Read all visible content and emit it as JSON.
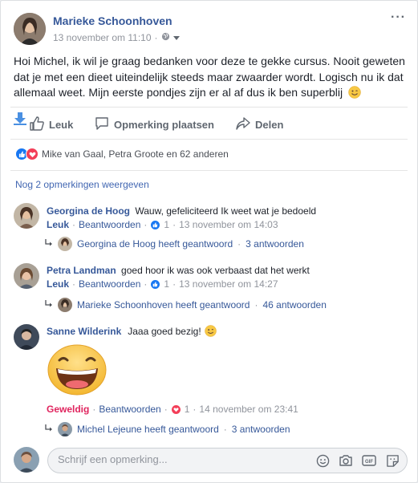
{
  "post": {
    "author": "Marieke Schoonhoven",
    "timestamp": "13 november om 11:10",
    "text": "Hoi Michel, ik wil je graag bedanken voor deze te gekke cursus. Nooit geweten dat je met een dieet uiteindelijk steeds maar zwaarder wordt. Logisch nu ik dat allemaal weet. Mijn eerste pondjes zijn er al af dus ik ben superblij",
    "more_label": "···"
  },
  "actions": {
    "like": "Leuk",
    "comment": "Opmerking plaatsen",
    "share": "Delen"
  },
  "reactions": {
    "summary": "Mike van Gaal, Petra Groote en 62 anderen"
  },
  "more_comments": "Nog 2 opmerkingen weergeven",
  "comments": [
    {
      "author": "Georgina de Hoog",
      "text": "Wauw, gefeliciteerd  Ik weet wat je bedoeld",
      "like_label": "Leuk",
      "reply_label": "Beantwoorden",
      "reaction_count": "1",
      "time": "13 november om 14:03",
      "reply": {
        "who": "Georgina de Hoog heeft geantwoord",
        "count": "3 antwoorden"
      }
    },
    {
      "author": "Petra Landman",
      "text": "goed hoor  ik was ook verbaast dat het werkt",
      "like_label": "Leuk",
      "reply_label": "Beantwoorden",
      "reaction_count": "1",
      "time": "13 november om 14:27",
      "reply": {
        "who": "Marieke Schoonhoven heeft geantwoord",
        "count": "46 antwoorden"
      }
    },
    {
      "author": "Sanne Wilderink",
      "text": "Jaaa goed bezig!",
      "like_label": "Geweldig",
      "reply_label": "Beantwoorden",
      "reaction_count": "1",
      "time": "14 november om 23:41",
      "reply": {
        "who": "Michel Lejeune heeft geantwoord",
        "count": "3 antwoorden"
      }
    }
  ],
  "composer": {
    "placeholder": "Schrijf een opmerking..."
  },
  "colors": {
    "link": "#365899",
    "like_blue": "#1877f2",
    "love_red": "#f33e58",
    "geweldig_red": "#e0245e"
  }
}
